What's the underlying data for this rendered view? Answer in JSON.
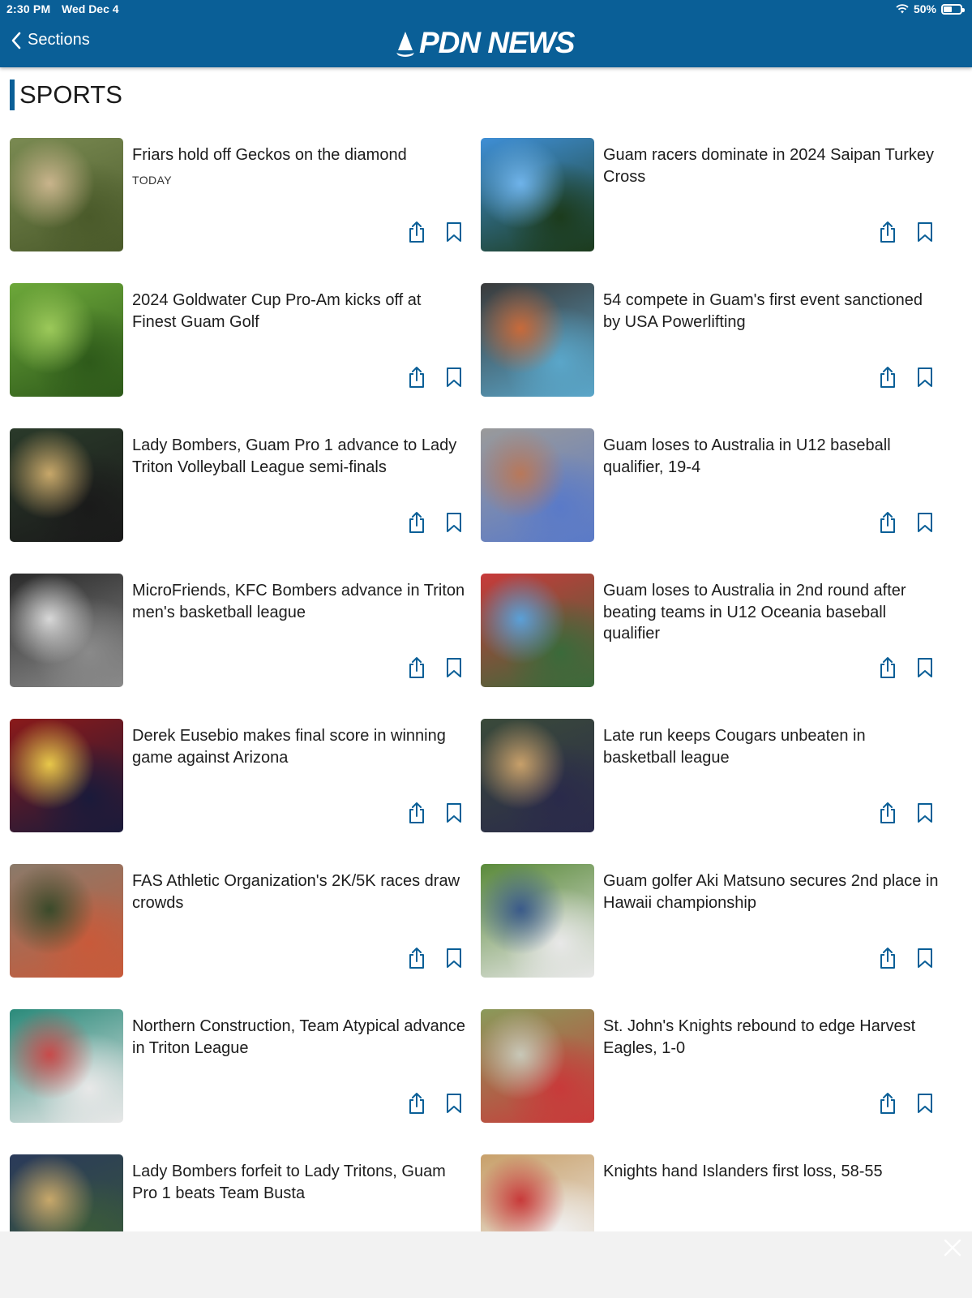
{
  "status": {
    "time": "2:30 PM",
    "date": "Wed Dec 4",
    "battery": "50%",
    "battery_level": 0.5
  },
  "nav": {
    "back_label": "Sections",
    "logo_text": "PDN NEWS"
  },
  "section": {
    "title": "SPORTS"
  },
  "articles": [
    {
      "title": "Friars hold off Geckos on the diamond",
      "meta": "TODAY",
      "colors": [
        "#7a8a52",
        "#c9b48c",
        "#4a5a2a"
      ]
    },
    {
      "title": "Guam racers dominate in 2024 Saipan Turkey Cross",
      "meta": "",
      "colors": [
        "#3f8fd6",
        "#6fb3ea",
        "#1c3b1c"
      ]
    },
    {
      "title": "2024 Goldwater Cup Pro-Am kicks off at Finest Guam Golf",
      "meta": "",
      "colors": [
        "#6da83a",
        "#9cc95a",
        "#2e5a1a"
      ]
    },
    {
      "title": "54 compete in Guam's first event sanctioned by USA Powerlifting",
      "meta": "",
      "colors": [
        "#3a3a3a",
        "#c86a3a",
        "#5aa6c9"
      ]
    },
    {
      "title": "Lady Bombers, Guam Pro 1 advance to Lady Triton Volleyball League semi-finals",
      "meta": "",
      "colors": [
        "#2a3a2a",
        "#c8a86a",
        "#1a1a1a"
      ]
    },
    {
      "title": "Guam loses to Australia in U12 baseball qualifier, 19-4",
      "meta": "",
      "colors": [
        "#9a9a9a",
        "#b8785a",
        "#5a7ac8"
      ]
    },
    {
      "title": "MicroFriends, KFC Bombers advance in Triton men's basketball league",
      "meta": "",
      "colors": [
        "#2a2a2a",
        "#d8d8d8",
        "#8a8a8a"
      ]
    },
    {
      "title": "Guam loses to Australia in 2nd round after beating teams in U12 Oceania baseball qualifier",
      "meta": "",
      "colors": [
        "#c83a3a",
        "#5aa0d8",
        "#3a6a3a"
      ]
    },
    {
      "title": "Derek Eusebio makes final score in winning game against Arizona",
      "meta": "",
      "colors": [
        "#8a1a1a",
        "#e8c84a",
        "#1a1a3a"
      ]
    },
    {
      "title": "Late run keeps Cougars unbeaten in basketball league",
      "meta": "",
      "colors": [
        "#3a4a3a",
        "#c8a06a",
        "#2a2a4a"
      ]
    },
    {
      "title": "FAS Athletic Organization's 2K/5K races draw crowds",
      "meta": "",
      "colors": [
        "#8a7a6a",
        "#3a4a2a",
        "#c85a3a"
      ]
    },
    {
      "title": "Guam golfer Aki Matsuno secures 2nd place in Hawaii championship",
      "meta": "",
      "colors": [
        "#5a8a3a",
        "#3a5a8a",
        "#e8e8e8"
      ]
    },
    {
      "title": "Northern Construction, Team Atypical advance in Triton League",
      "meta": "",
      "colors": [
        "#2a8a7a",
        "#c84a4a",
        "#e8e8e8"
      ]
    },
    {
      "title": "St. John's Knights rebound to edge Harvest Eagles, 1-0",
      "meta": "",
      "colors": [
        "#8a9a5a",
        "#c8c8b8",
        "#c83a3a"
      ]
    },
    {
      "title": "Lady Bombers forfeit to Lady Tritons, Guam Pro 1 beats Team Busta",
      "meta": "",
      "colors": [
        "#2a3a5a",
        "#c8a86a",
        "#3a5a3a"
      ]
    },
    {
      "title": "Knights hand Islanders first loss, 58-55",
      "meta": "",
      "colors": [
        "#c8a06a",
        "#c83a3a",
        "#f0f0f0"
      ]
    }
  ],
  "colors": {
    "brand": "#0a5f97",
    "icon": "#0a5f97"
  }
}
